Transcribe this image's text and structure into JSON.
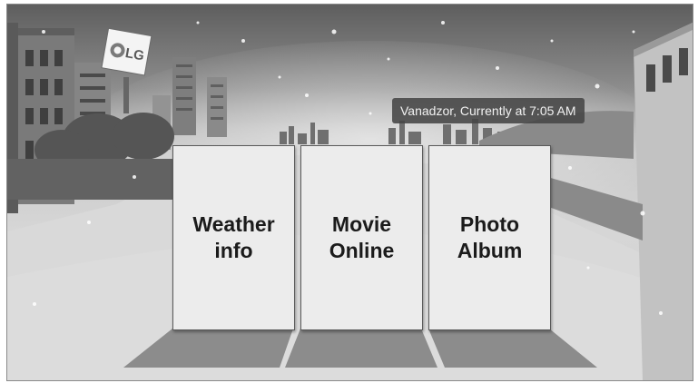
{
  "app": {
    "logo_text": "LG"
  },
  "status": {
    "location_text": "Vanadzor, Currently at 7:05 AM"
  },
  "tiles": [
    {
      "id": "weather",
      "label": "Weather info"
    },
    {
      "id": "movie",
      "label": "Movie Online"
    },
    {
      "id": "photo",
      "label": "Photo Album"
    }
  ],
  "colors": {
    "tile_background": "#ececec",
    "label_background": "#464646",
    "sky_top": "#5e5e5e",
    "snow_ground": "#d6d6d6"
  }
}
